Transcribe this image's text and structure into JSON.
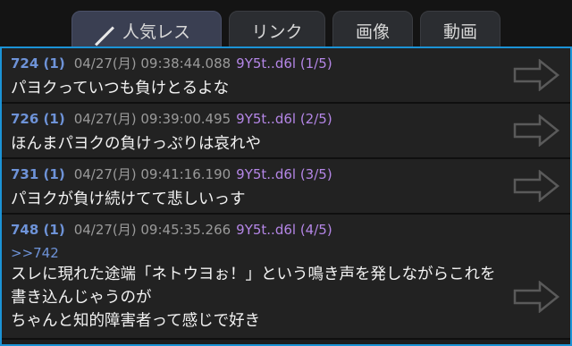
{
  "tabs": [
    {
      "label": "人気レス",
      "active": true
    },
    {
      "label": "リンク"
    },
    {
      "label": "画像"
    },
    {
      "label": "動画"
    }
  ],
  "posts": [
    {
      "num": "724 (1)",
      "date": "04/27(月) 09:38:44.088",
      "uid": "9Y5t..d6l (1/5)",
      "body": "パヨクっていつも負けとるよな"
    },
    {
      "num": "726 (1)",
      "date": "04/27(月) 09:39:00.495",
      "uid": "9Y5t..d6l (2/5)",
      "body": "ほんまパヨクの負けっぷりは哀れや"
    },
    {
      "num": "731 (1)",
      "date": "04/27(月) 09:41:16.190",
      "uid": "9Y5t..d6l (3/5)",
      "body": "パヨクが負け続けてて悲しいっす"
    },
    {
      "num": "748 (1)",
      "date": "04/27(月) 09:45:35.266",
      "uid": "9Y5t..d6l (4/5)",
      "anchor": ">>742",
      "body_lines": [
        "スレに現れた途端「ネトウヨぉ！」という鳴き声を発しながらこれを書き込んじゃうのが",
        "ちゃんと知的障害者って感じで好き"
      ]
    }
  ],
  "colors": {
    "accent_border": "#1b93d6",
    "post_number": "#6e93d8",
    "user_id": "#b486e6",
    "date": "#9a9a9a"
  },
  "icons": {
    "pencil": "pencil-icon",
    "arrow": "arrow-right-icon"
  }
}
